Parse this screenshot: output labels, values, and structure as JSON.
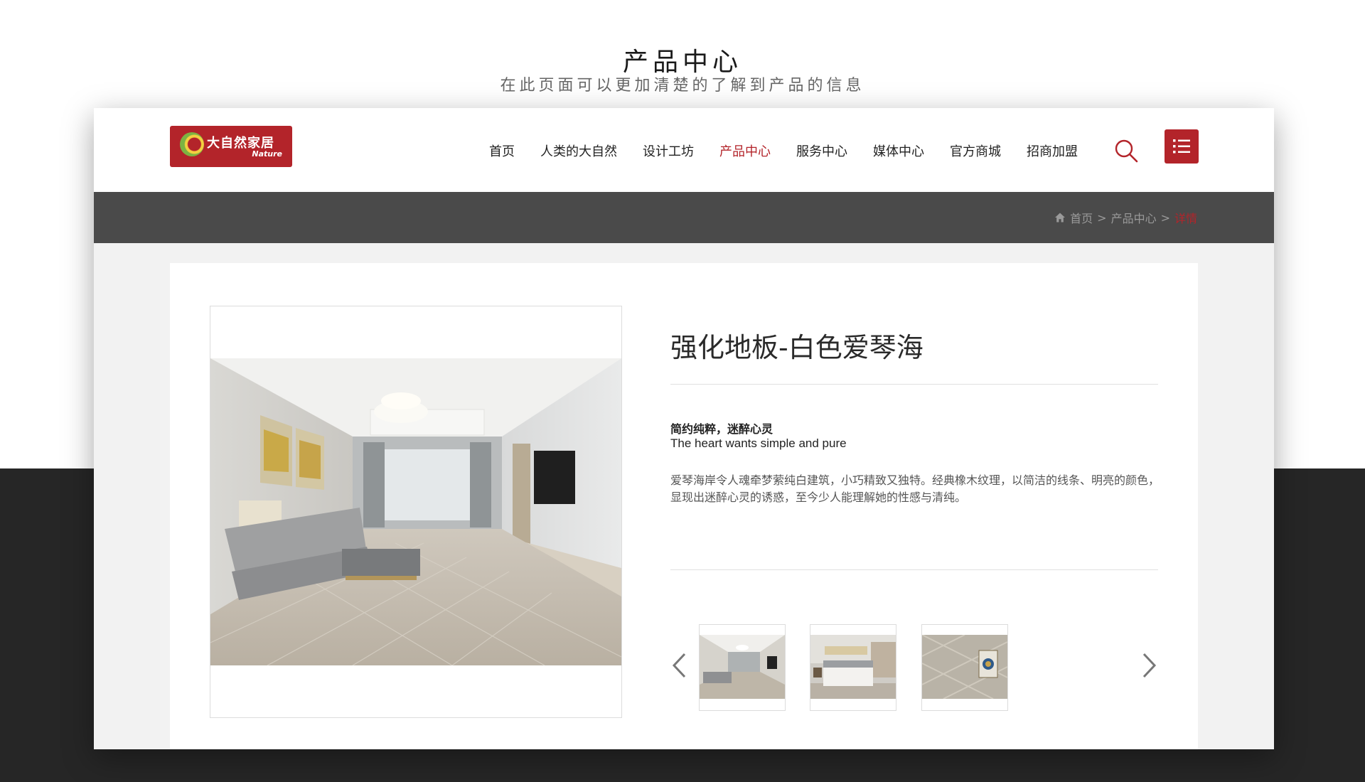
{
  "page": {
    "heading": "产品中心",
    "subheading": "在此页面可以更加清楚的了解到产品的信息"
  },
  "brand": {
    "logo_cn": "大自然家居",
    "logo_en": "Nature"
  },
  "nav": {
    "items": [
      {
        "label": "首页"
      },
      {
        "label": "人类的大自然"
      },
      {
        "label": "设计工坊"
      },
      {
        "label": "产品中心",
        "active": true
      },
      {
        "label": "服务中心"
      },
      {
        "label": "媒体中心"
      },
      {
        "label": "官方商城"
      },
      {
        "label": "招商加盟"
      }
    ],
    "search_icon": "search-icon",
    "menu_icon": "list-menu-icon"
  },
  "breadcrumb": {
    "home_icon": "home-icon",
    "home": "首页",
    "section": "产品中心",
    "separator": ">",
    "current": "详情"
  },
  "product": {
    "title": "强化地板-白色爱琴海",
    "subtitle_cn": "简约纯粹，迷醉心灵",
    "subtitle_en": "The heart wants simple and pure",
    "description": "爱琴海岸令人魂牵梦萦纯白建筑，小巧精致又独特。经典橡木纹理，以简洁的线条、明亮的颜色，显现出迷醉心灵的诱惑，至今少人能理解她的性感与清纯。",
    "gallery": {
      "prev_icon": "chevron-left-icon",
      "next_icon": "chevron-right-icon",
      "thumbnails": [
        "living-room-photo",
        "bedroom-photo",
        "floor-closeup-photo"
      ]
    }
  },
  "colors": {
    "accent": "#b3242a",
    "breadcrumb_bar": "#4a4a4a",
    "bottom_band": "#262626",
    "card_background": "#f2f2f2"
  }
}
